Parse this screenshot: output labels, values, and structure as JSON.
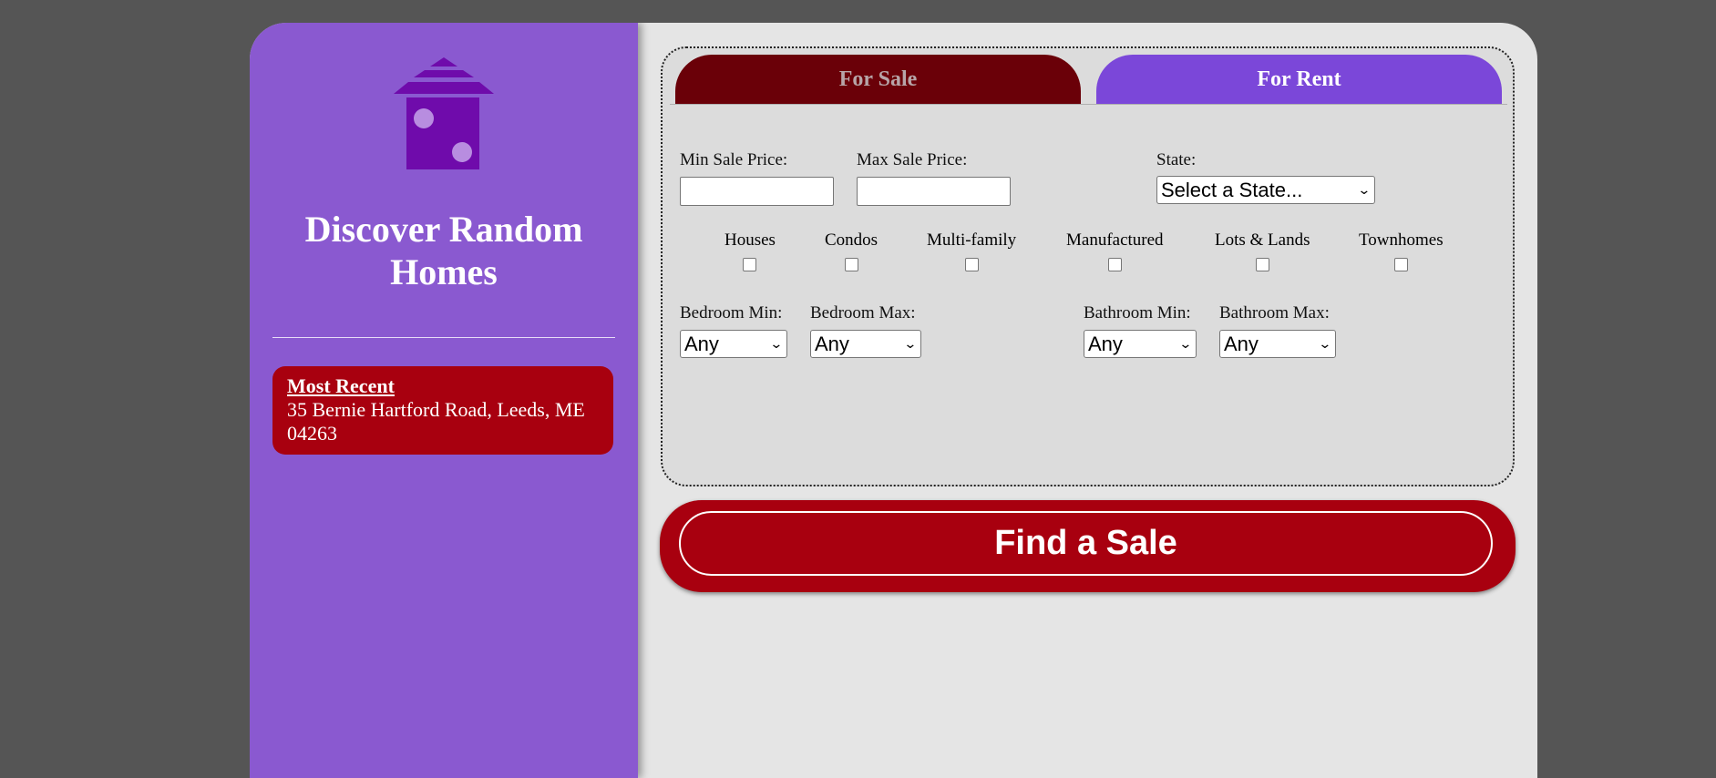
{
  "sidebar": {
    "title": "Discover Random Homes",
    "logo_icon": "house-dice-icon",
    "recent": {
      "title": "Most Recent",
      "address": "35 Bernie Hartford Road, Leeds, ME 04263"
    }
  },
  "tabs": {
    "sale": "For Sale",
    "rent": "For Rent"
  },
  "search": {
    "min_price_label": "Min Sale Price:",
    "min_price_value": "",
    "max_price_label": "Max Sale Price:",
    "max_price_value": "",
    "state_label": "State:",
    "state_selected": "Select a State...",
    "property_types": [
      "Houses",
      "Condos",
      "Multi-family",
      "Manufactured",
      "Lots & Lands",
      "Townhomes"
    ],
    "bed_min_label": "Bedroom Min:",
    "bed_min_value": "Any",
    "bed_max_label": "Bedroom Max:",
    "bed_max_value": "Any",
    "bath_min_label": "Bathroom Min:",
    "bath_min_value": "Any",
    "bath_max_label": "Bathroom Max:",
    "bath_max_value": "Any"
  },
  "find_button": "Find a Sale",
  "colors": {
    "background": "#555555",
    "sidebar": "#8a59d0",
    "accent_red": "#a8000f",
    "tab_sale": "#6a0008",
    "tab_rent": "#7b47d9",
    "logo": "#6f0bab"
  }
}
